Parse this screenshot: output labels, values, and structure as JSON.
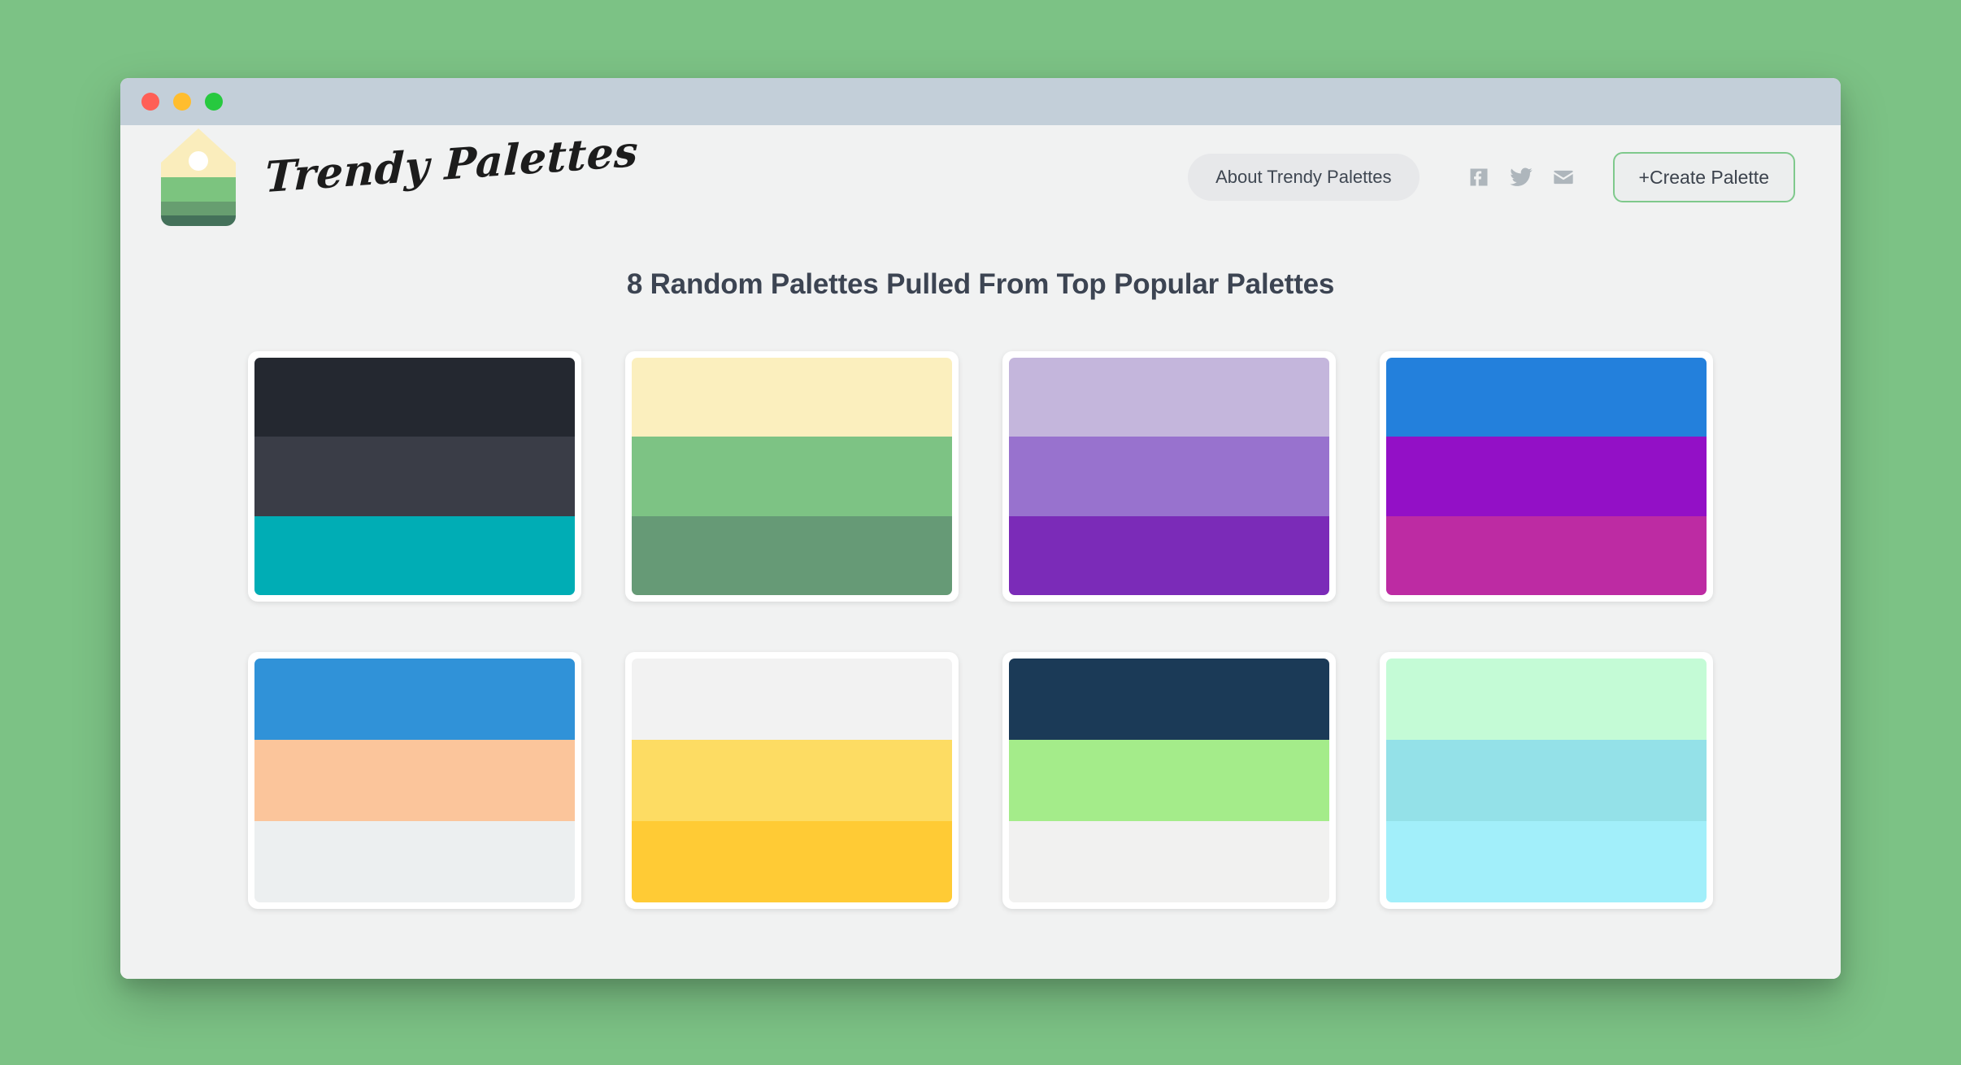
{
  "window": {
    "traffic_lights": [
      {
        "name": "close",
        "color": "#ff5f56"
      },
      {
        "name": "minimize",
        "color": "#ffbd2e"
      },
      {
        "name": "maximize",
        "color": "#27c93f"
      }
    ]
  },
  "header": {
    "brand_name": "Trendy Palettes",
    "about_label": "About Trendy Palettes",
    "create_label": "+Create Palette",
    "social": [
      {
        "name": "facebook-icon"
      },
      {
        "name": "twitter-icon"
      },
      {
        "name": "email-icon"
      }
    ],
    "logo": {
      "tag_top_color": "#faedbc",
      "hole_color": "#ffffff",
      "band_colors": [
        "#7cc47f",
        "#679e70",
        "#44715a"
      ]
    },
    "accent_green": "#7fc98c",
    "social_icon_color": "#aeb6bc"
  },
  "main": {
    "title": "8 Random Palettes Pulled From Top Popular Palettes",
    "palette_count": 8,
    "page_background": "#f1f2f2",
    "outer_background": "#7cc285",
    "titlebar_background": "#c3cfd9",
    "palettes": [
      {
        "id": 1,
        "colors": [
          "#242830",
          "#3a3d47",
          "#00adb5"
        ]
      },
      {
        "id": 2,
        "colors": [
          "#fbefbe",
          "#7dc384",
          "#669a76"
        ]
      },
      {
        "id": 3,
        "colors": [
          "#c4b6dc",
          "#9872ce",
          "#7b2bb8"
        ]
      },
      {
        "id": 4,
        "colors": [
          "#2380dc",
          "#9310c6",
          "#bd2ba3"
        ]
      },
      {
        "id": 5,
        "colors": [
          "#3092d8",
          "#fbc59b",
          "#eceff0"
        ]
      },
      {
        "id": 6,
        "colors": [
          "#f2f2f2",
          "#fddc63",
          "#ffcb35"
        ]
      },
      {
        "id": 7,
        "colors": [
          "#1b3a57",
          "#a4ec8a",
          "#f1f1f0"
        ]
      },
      {
        "id": 8,
        "colors": [
          "#c4fbd6",
          "#94e1e8",
          "#a2effa"
        ]
      }
    ]
  }
}
